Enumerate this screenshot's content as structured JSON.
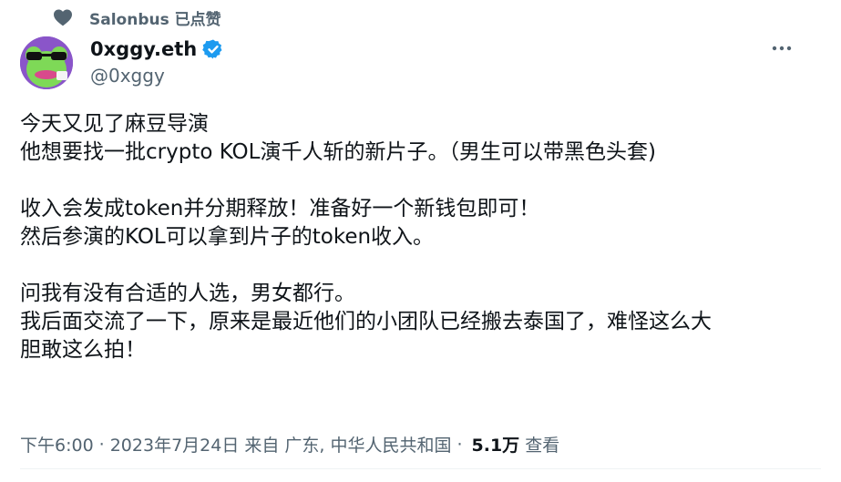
{
  "social_context": {
    "text": "Salonbus 已点赞",
    "icon": "heart-icon"
  },
  "author": {
    "display_name": "0xggy.eth",
    "handle": "@0xggy",
    "verified": true,
    "verified_color": "#1d9bf0",
    "avatar": "avatar-cartoon-frog"
  },
  "post": {
    "lines": [
      "今天又见了麻豆导演",
      "他想要找一批crypto KOL演千人斩的新片子。（男生可以带黑色头套)",
      "",
      "收入会发成token并分期释放！准备好一个新钱包即可！",
      "然后参演的KOL可以拿到片子的token收入。",
      "",
      "问我有没有合适的人选，男女都行。",
      "我后面交流了一下，原来是最近他们的小团队已经搬去泰国了，难怪这么大",
      "胆敢这么拍！"
    ]
  },
  "meta": {
    "time": "下午6:00",
    "date": "2023年7月24日",
    "source": "来自 广东, 中华人民共和国",
    "views_count": "5.1万",
    "views_label": "查看",
    "separator": "·"
  },
  "more_icon": "more-horizontal-icon"
}
